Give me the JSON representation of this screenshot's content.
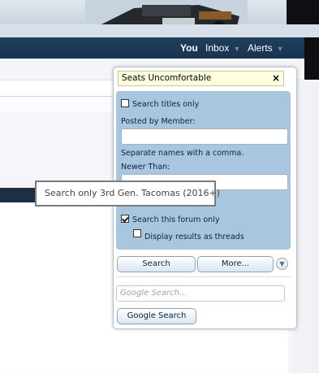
{
  "nav": {
    "you": "You",
    "inbox": "Inbox",
    "alerts": "Alerts",
    "arrow": "▼"
  },
  "search_popup": {
    "query": "Seats Uncomfortable",
    "close": "×",
    "titles_only": "Search titles only",
    "posted_by_label": "Posted by Member:",
    "separate_hint": "Separate names with a comma.",
    "newer_than_label": "Newer Than:",
    "this_forum_only": "Search this forum only",
    "display_as_threads": "Display results as threads",
    "search_button": "Search",
    "more_button": "More...",
    "google_placeholder": "Google Search...",
    "google_button": "Google Search"
  },
  "checkbox_states": {
    "titles_only": false,
    "this_forum_only": true,
    "display_as_threads": false
  },
  "tooltip": "Search only 3rd Gen. Tacomas (2016+)",
  "icons": {
    "close": "close-icon",
    "expand": "chevron-down-icon",
    "dropdown": "triangle-down-icon"
  }
}
